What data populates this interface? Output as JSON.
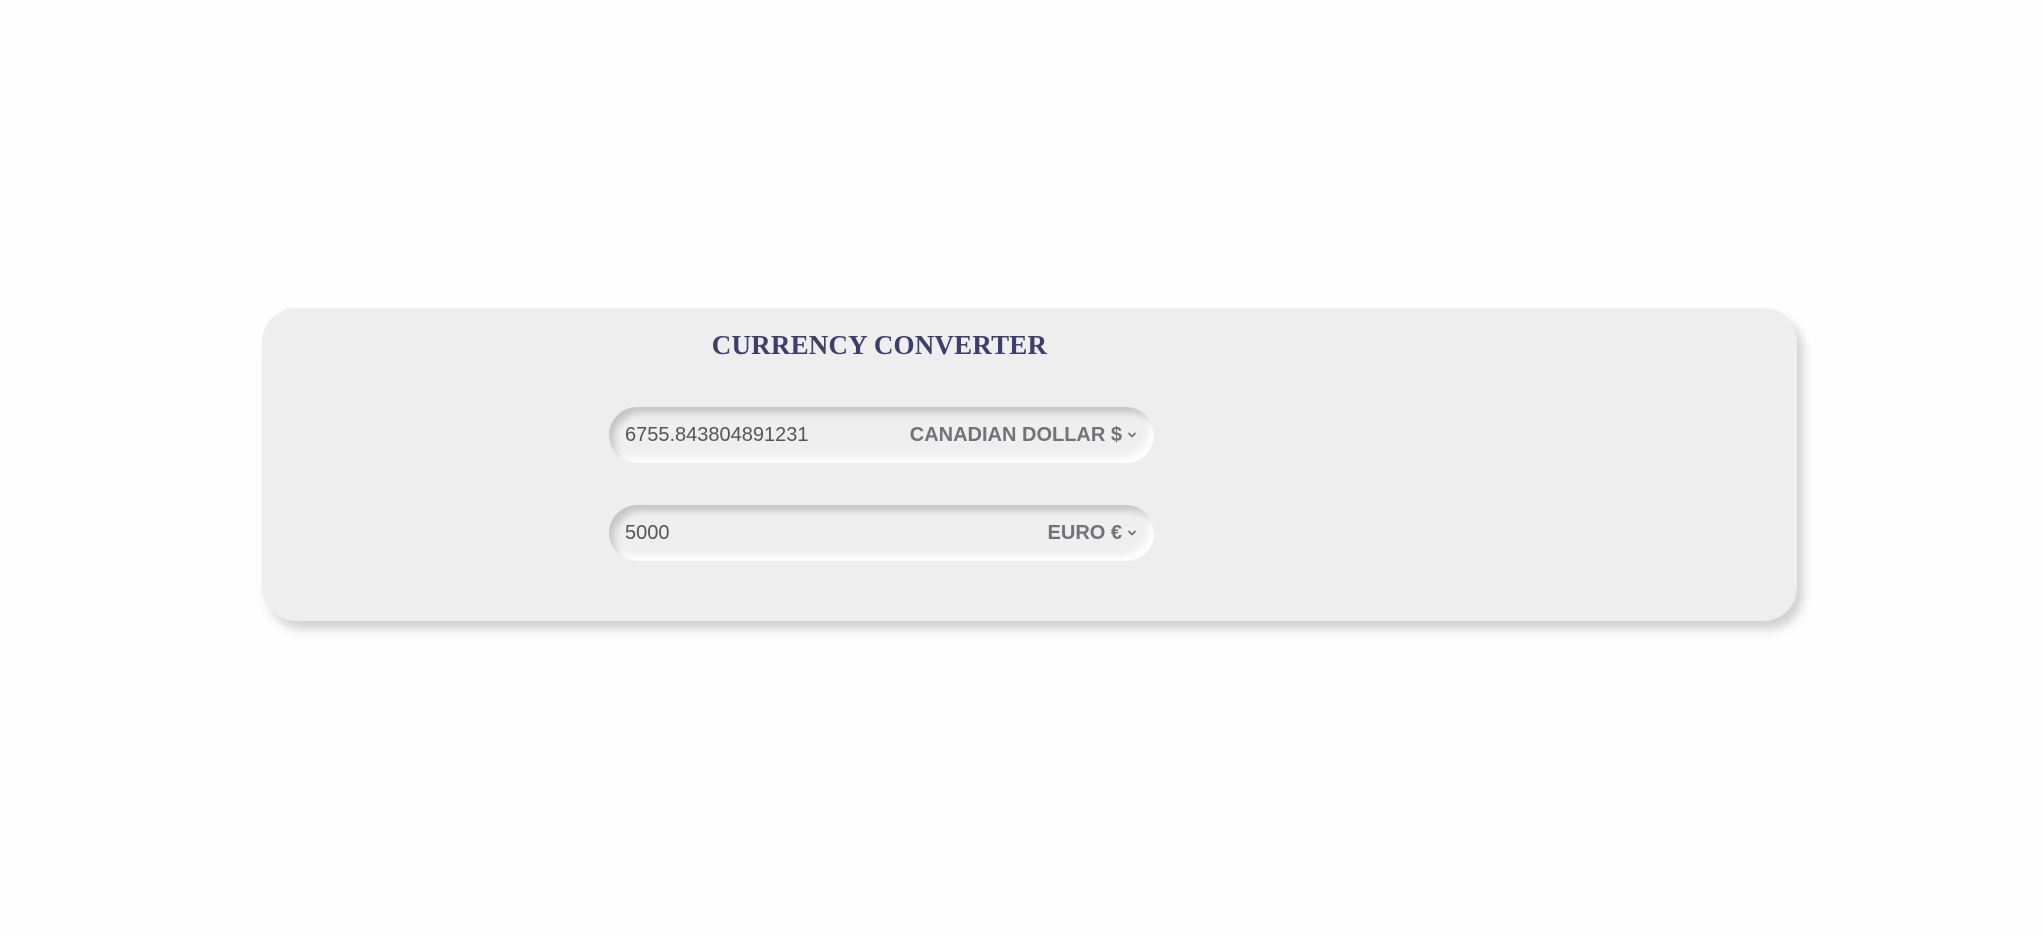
{
  "converter": {
    "title": "CURRENCY CONVERTER",
    "from": {
      "value": "6755.843804891231",
      "currency": "CANADIAN DOLLAR $"
    },
    "to": {
      "value": "5000",
      "currency": "EURO €"
    }
  },
  "icons": {
    "dropdown": "chevron-down-icon"
  },
  "colors": {
    "title": "#3d3f6b",
    "card": "#eeeeee",
    "currency_label": "#727279"
  }
}
